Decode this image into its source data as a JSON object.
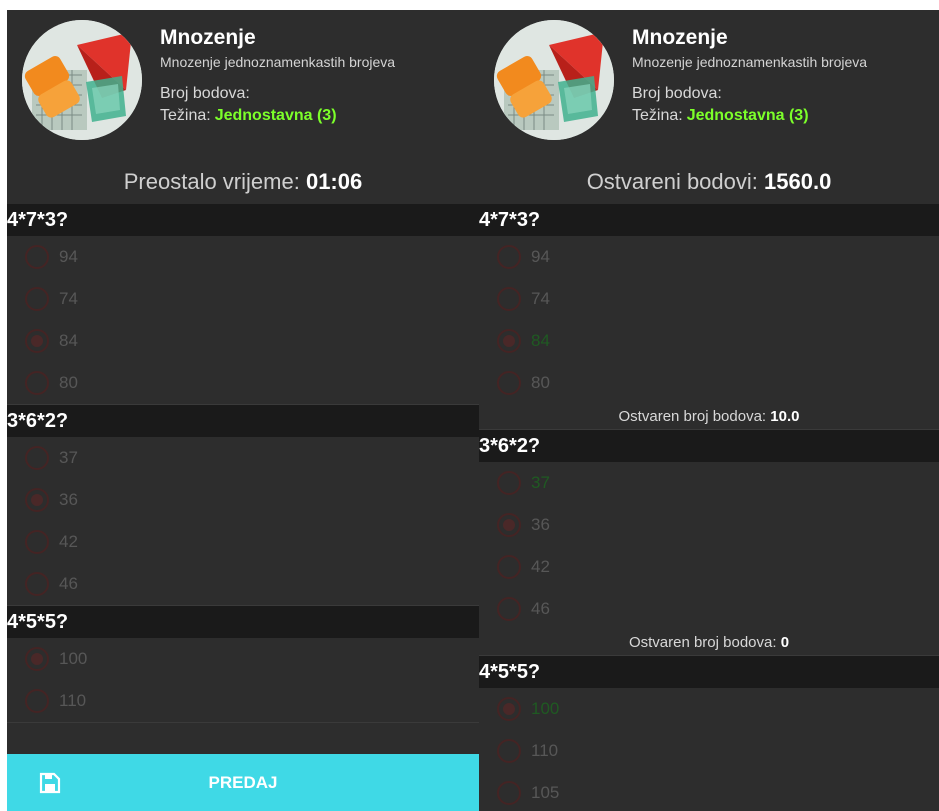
{
  "header": {
    "title": "Mnozenje",
    "subtitle": "Mnozenje jednoznamenkastih brojeva",
    "points_label": "Broj bodova:",
    "difficulty_label": "Težina:",
    "difficulty_value": "Jednostavna (3)"
  },
  "left": {
    "timer_label": "Preostalo vrijeme:",
    "timer_value": "01:06",
    "questions": [
      {
        "text": "4*7*3?",
        "options": [
          "94",
          "74",
          "84",
          "80"
        ],
        "selected": 2
      },
      {
        "text": "3*6*2?",
        "options": [
          "37",
          "36",
          "42",
          "46"
        ],
        "selected": 1
      },
      {
        "text": "4*5*5?",
        "options": [
          "100",
          "110"
        ],
        "selected": 0
      }
    ],
    "submit_label": "PREDAJ",
    "submit_icon": "save-icon"
  },
  "right": {
    "total_label": "Ostvareni bodovi:",
    "total_value": "1560.0",
    "score_label": "Ostvaren broj bodova:",
    "questions": [
      {
        "text": "4*7*3?",
        "options": [
          "94",
          "74",
          "84",
          "80"
        ],
        "selected": 2,
        "correct": 2,
        "score": "10.0"
      },
      {
        "text": "3*6*2?",
        "options": [
          "37",
          "36",
          "42",
          "46"
        ],
        "selected": 1,
        "correct": 0,
        "score": "0"
      },
      {
        "text": "4*5*5?",
        "options": [
          "100",
          "110",
          "105"
        ],
        "selected": 0,
        "correct": 0
      }
    ]
  },
  "colors": {
    "panel_bg": "#2d2d2d",
    "question_bar": "#1a1a1a",
    "difficulty": "#7cff2a",
    "correct_answer": "#1f5a22",
    "submit_bar": "#3fd9e6"
  }
}
